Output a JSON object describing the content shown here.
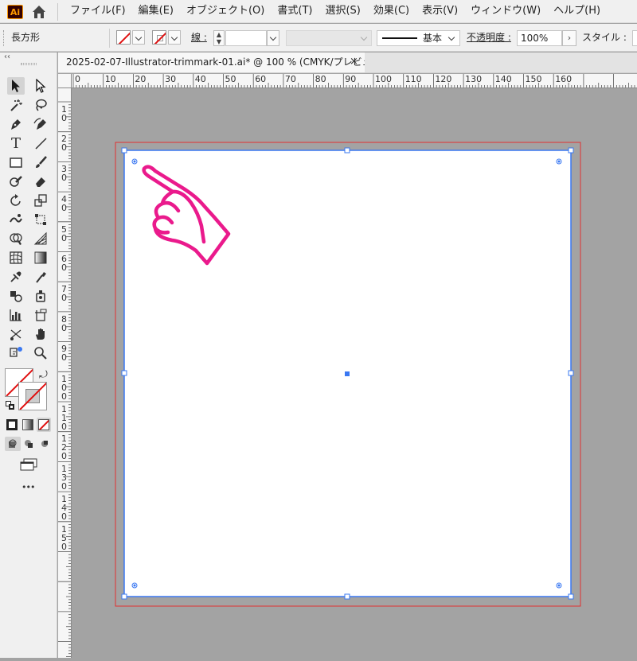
{
  "menubar": {
    "app_logo": "Ai",
    "items": [
      "ファイル(F)",
      "編集(E)",
      "オブジェクト(O)",
      "書式(T)",
      "選択(S)",
      "効果(C)",
      "表示(V)",
      "ウィンドウ(W)",
      "ヘルプ(H)"
    ]
  },
  "controlbar": {
    "selection_type": "長方形",
    "stroke_label": "線 :",
    "stroke_profile": "基本",
    "opacity_label": "不透明度 :",
    "opacity_value": "100%",
    "style_label": "スタイル :"
  },
  "document": {
    "tab_title": "2025-02-07-Illustrator-trimmark-01.ai* @ 100 % (CMYK/プレビュー)",
    "close_glyph": "×"
  },
  "rulers": {
    "horizontal": [
      "0",
      "10",
      "20",
      "30",
      "40",
      "50",
      "60",
      "70",
      "80",
      "90",
      "100",
      "110",
      "120",
      "130",
      "140",
      "150",
      "160"
    ],
    "vertical": [
      "1\n0",
      "2\n0",
      "3\n0",
      "4\n0",
      "5\n0",
      "6\n0",
      "7\n0",
      "8\n0",
      "9\n0",
      "1\n0\n0",
      "1\n1\n0",
      "1\n2\n0",
      "1\n3\n0",
      "1\n4\n0",
      "1\n5\n0"
    ]
  },
  "toolbar": {
    "more_glyph": "•••"
  },
  "colors": {
    "trim_red": "#e03030",
    "selection_blue": "#3a78f2",
    "hand_magenta": "#ea1a8c"
  },
  "icons": [
    "ai-logo-icon",
    "home-icon",
    "selection-tool-icon",
    "direct-selection-tool-icon",
    "magic-wand-icon",
    "lasso-icon",
    "pen-tool-icon",
    "curvature-tool-icon",
    "type-tool-icon",
    "line-tool-icon",
    "rectangle-tool-icon",
    "paintbrush-icon",
    "shaper-tool-icon",
    "eraser-icon",
    "rotate-icon",
    "scale-icon",
    "warp-icon",
    "free-transform-icon",
    "shape-builder-icon",
    "perspective-grid-icon",
    "mesh-icon",
    "gradient-icon",
    "eyedropper-icon",
    "blend-icon",
    "symbol-sprayer-icon",
    "column-graph-icon",
    "artboard-tool-icon",
    "slice-tool-icon",
    "hand-tool-icon",
    "zoom-tool-icon",
    "pointing-hand-icon"
  ]
}
